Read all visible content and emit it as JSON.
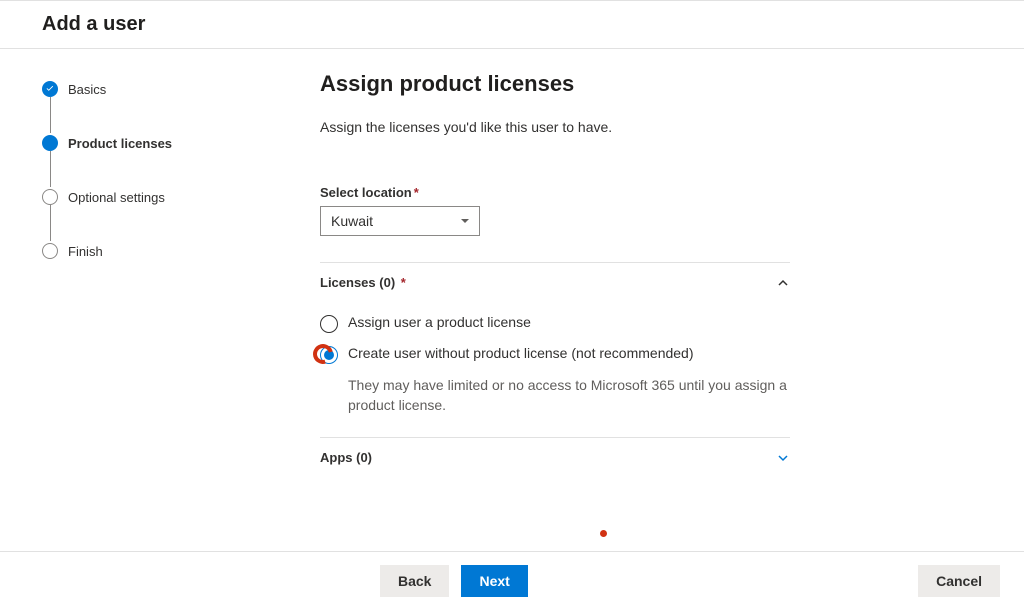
{
  "header": {
    "title": "Add a user"
  },
  "stepper": {
    "steps": [
      {
        "label": "Basics",
        "state": "completed"
      },
      {
        "label": "Product licenses",
        "state": "current"
      },
      {
        "label": "Optional settings",
        "state": "upcoming"
      },
      {
        "label": "Finish",
        "state": "upcoming"
      }
    ]
  },
  "main": {
    "heading": "Assign product licenses",
    "subtitle": "Assign the licenses you'd like this user to have.",
    "location": {
      "label": "Select location",
      "value": "Kuwait"
    },
    "licenses": {
      "title": "Licenses (0)",
      "options": {
        "assign": "Assign user a product license",
        "without": "Create user without product license (not recommended)",
        "without_desc": "They may have limited or no access to Microsoft 365 until you assign a product license."
      },
      "selected": "without"
    },
    "apps": {
      "title": "Apps (0)"
    }
  },
  "footer": {
    "back": "Back",
    "next": "Next",
    "cancel": "Cancel"
  }
}
